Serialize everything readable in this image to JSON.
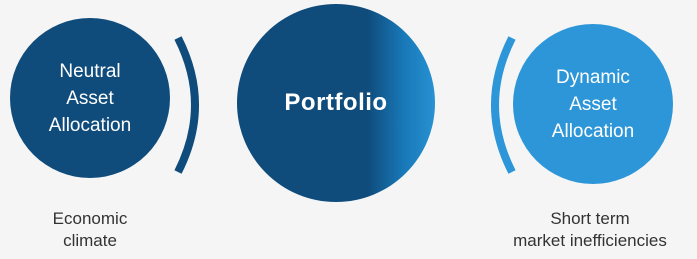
{
  "diagram": {
    "left_node": {
      "lines": [
        "Neutral",
        "Asset",
        "Allocation"
      ],
      "caption_lines": [
        "Economic",
        "climate"
      ],
      "color": "#0f4c7c"
    },
    "center_node": {
      "label": "Portfolio",
      "color": "#0f4c7c",
      "gradient_edge_color": "#2892d2"
    },
    "right_node": {
      "lines": [
        "Dynamic",
        "Asset",
        "Allocation"
      ],
      "caption_lines": [
        "Short term",
        "market inefficiencies"
      ],
      "color": "#2c96d8"
    },
    "bracket_left_color": "#0f4c7c",
    "bracket_right_color": "#2c96d8"
  }
}
